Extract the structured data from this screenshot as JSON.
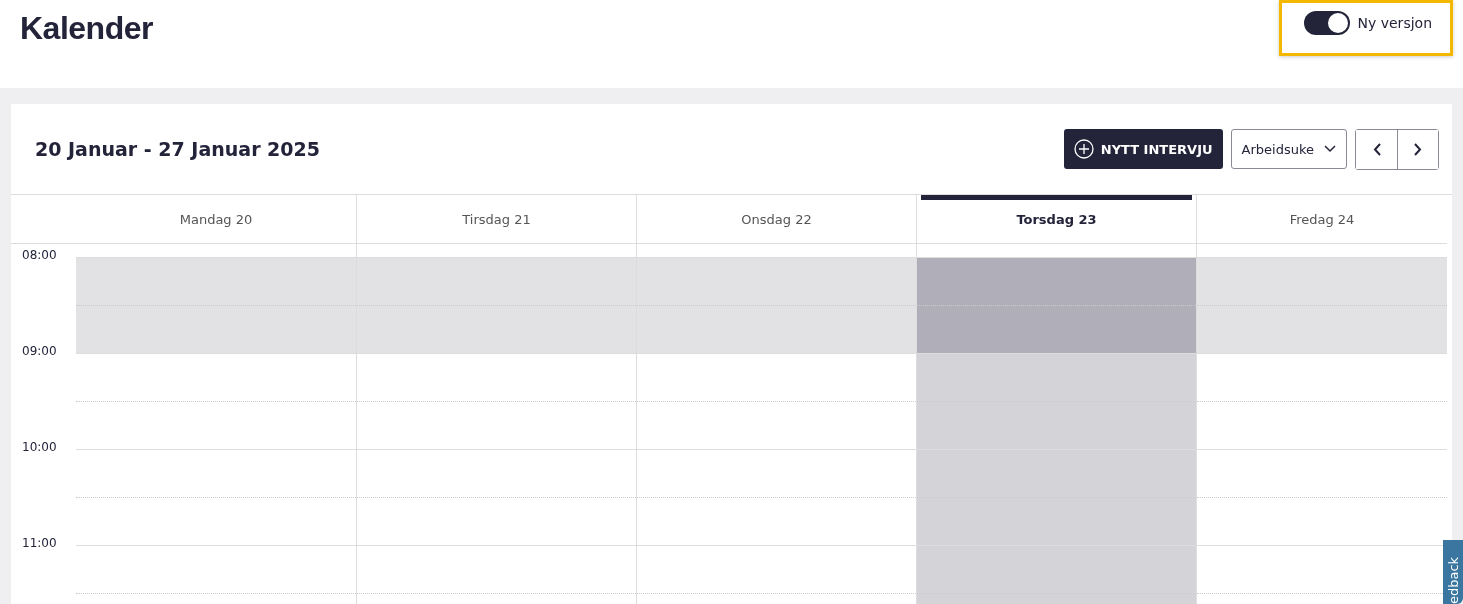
{
  "page": {
    "title": "Kalender"
  },
  "version_toggle": {
    "label": "Ny versjon",
    "on": true
  },
  "calendar": {
    "range_title": "20 Januar - 27 Januar 2025",
    "new_button": "NYTT INTERVJU",
    "view_select": "Arbeidsuke",
    "days": [
      {
        "label": "Mandag 20",
        "selected": false
      },
      {
        "label": "Tirsdag 21",
        "selected": false
      },
      {
        "label": "Onsdag 22",
        "selected": false
      },
      {
        "label": "Torsdag 23",
        "selected": true
      },
      {
        "label": "Fredag 24",
        "selected": false
      }
    ],
    "hours": [
      {
        "label": "08:00",
        "past": true
      },
      {
        "label": "09:00",
        "past": false
      },
      {
        "label": "10:00",
        "past": false
      },
      {
        "label": "11:00",
        "past": false
      }
    ]
  },
  "feedback_tab": {
    "label": "edback"
  }
}
